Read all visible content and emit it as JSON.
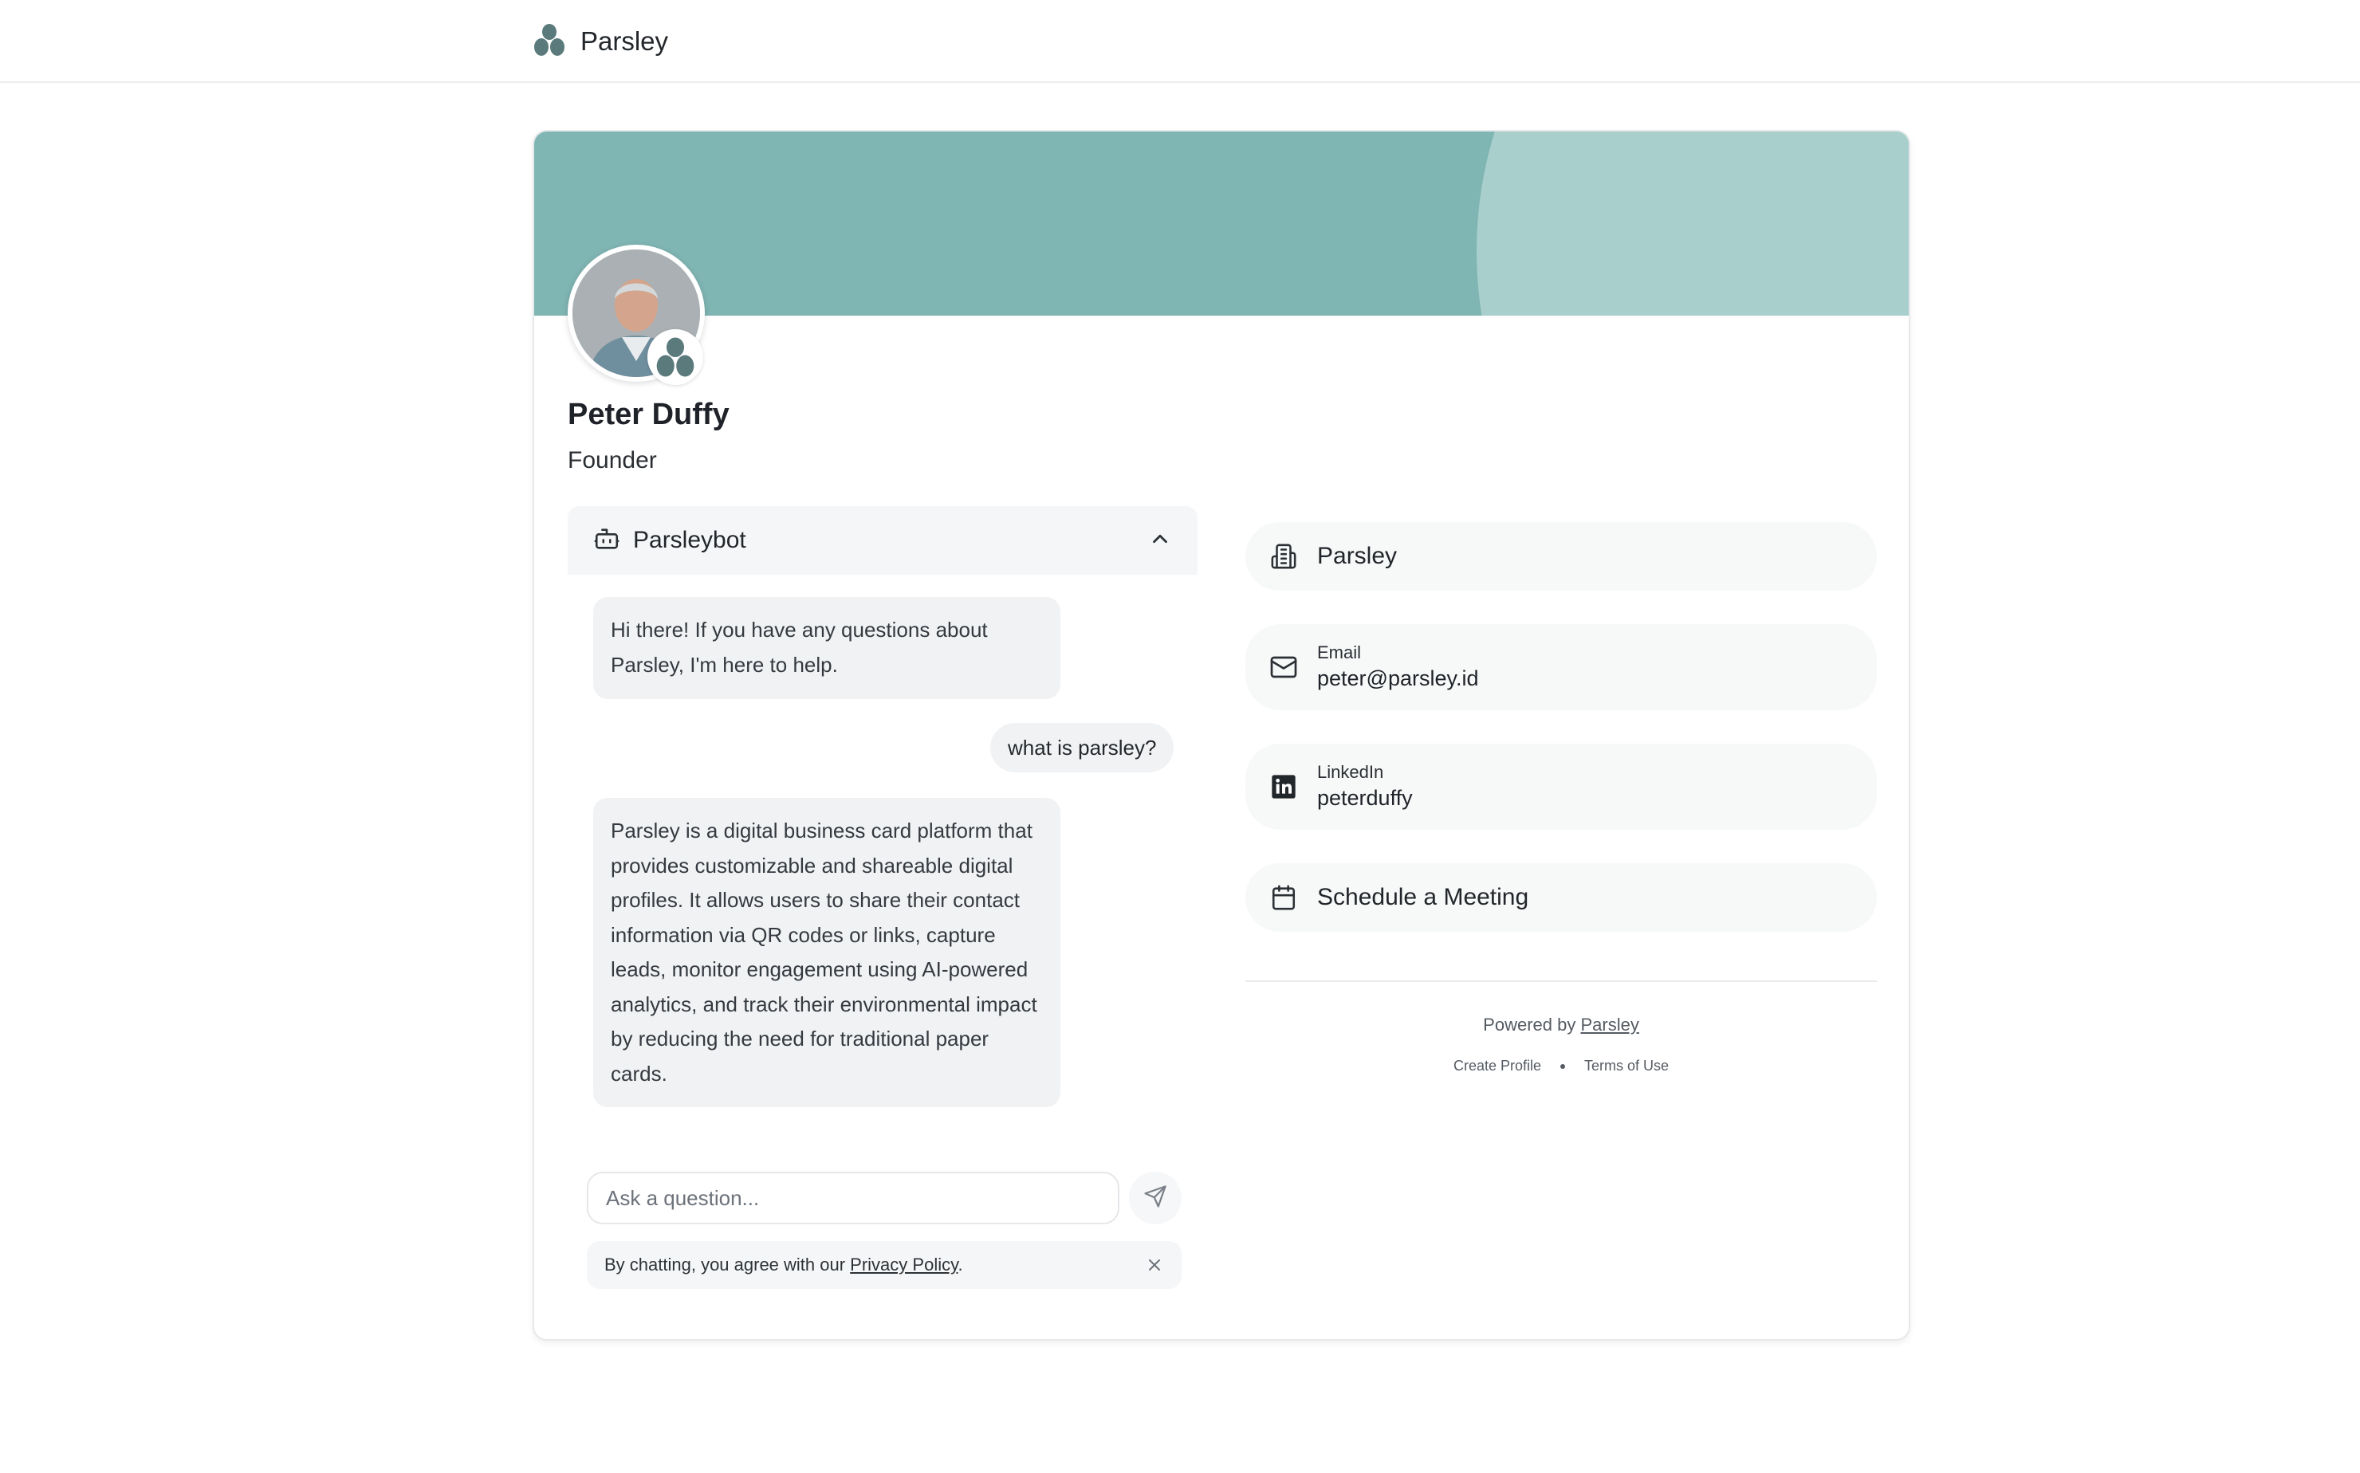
{
  "nav": {
    "brand": "Parsley",
    "logo_icon": "parsley-logo-icon"
  },
  "profile": {
    "name": "Peter Duffy",
    "role": "Founder",
    "avatar_icon": "profile-photo",
    "badge_icon": "parsley-logo-icon",
    "banner_color": "#7fb5b3",
    "banner_accent": "#a8cfcc"
  },
  "chat": {
    "title": "Parsleybot",
    "bot_icon": "bot-icon",
    "toggle_icon": "chevron-up-icon",
    "messages": [
      {
        "from": "bot",
        "text": "Hi there! If you have any questions about Parsley, I'm here to help."
      },
      {
        "from": "user",
        "text": "what is parsley?"
      },
      {
        "from": "bot",
        "text": "Parsley is a digital business card platform that provides customizable and shareable digital profiles. It allows users to share their contact information via QR codes or links, capture leads, monitor engagement using AI-powered analytics, and track their environmental impact by reducing the need for traditional paper cards."
      }
    ],
    "input_placeholder": "Ask a question...",
    "input_value": "",
    "send_icon": "send-icon",
    "privacy_prefix": "By chatting, you agree with our ",
    "privacy_link": "Privacy Policy",
    "privacy_suffix": ".",
    "close_icon": "close-icon"
  },
  "links": {
    "company": {
      "label": "Parsley",
      "icon": "building-icon"
    },
    "email": {
      "label": "Email",
      "value": "peter@parsley.id",
      "icon": "mail-icon"
    },
    "linkedin": {
      "label": "LinkedIn",
      "value": "peterduffy",
      "icon": "linkedin-icon"
    },
    "meeting": {
      "label": "Schedule a Meeting",
      "icon": "calendar-icon"
    }
  },
  "footer": {
    "powered_prefix": "Powered by ",
    "powered_link": "Parsley",
    "create_profile": "Create Profile",
    "terms": "Terms of Use"
  },
  "colors": {
    "accent": "#7fb5b3",
    "logo": "#5a7a7c"
  }
}
